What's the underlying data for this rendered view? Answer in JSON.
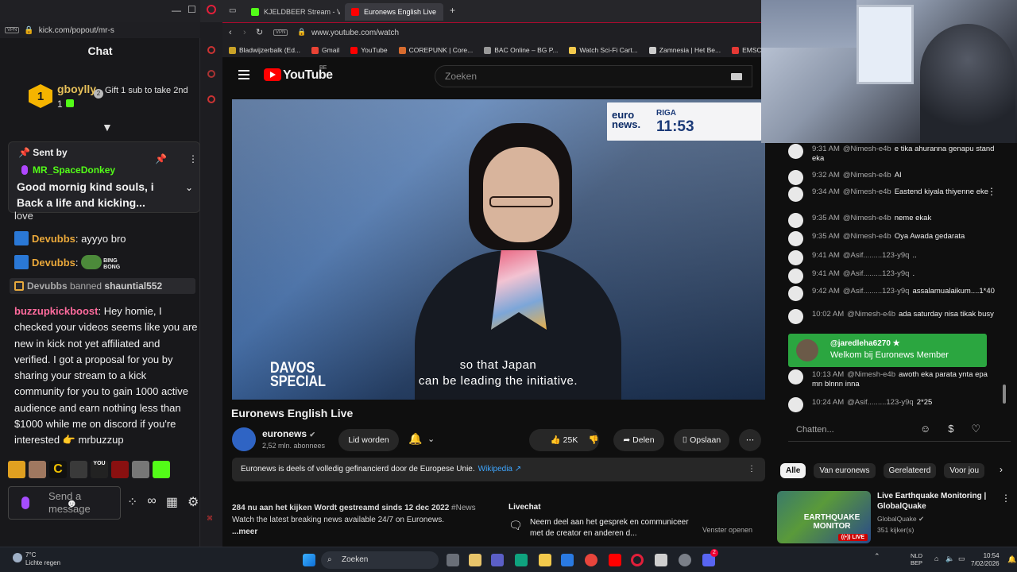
{
  "kick": {
    "url": "kick.com/popout/mr-s",
    "chat_title": "Chat",
    "gift": {
      "user": "gboylly",
      "rank": "1",
      "count": "1",
      "cta": "Gift 1 sub to take 2nd",
      "cta_num": "2"
    },
    "pinned": {
      "sent_by": "Sent by",
      "user": "MR_SpaceDonkey",
      "message": "Good mornig kind souls, i Back a life and kicking..."
    },
    "partial_line": "love",
    "messages": [
      {
        "user": "Devubbs",
        "text": "ayyyo bro"
      },
      {
        "user": "Devubbs",
        "text": ""
      }
    ],
    "ban": {
      "moderator": "Devubbs",
      "action": "banned",
      "target": "shauntial552"
    },
    "long_message": {
      "user": "buzzupkickboost",
      "text": "Hey homie, I checked your videos seems like you are new in kick not yet affiliated and verified. I got a proposal for you by sharing your stream to a kick community for you to gain 1000 active audience and earn nothing less than $1000 while me on discord if you're interested 👉 mrbuzzup"
    },
    "send_placeholder": "Send a message",
    "emote_text": {
      "bing": "BING BONG",
      "c": "C",
      "you": "YOU"
    }
  },
  "browser": {
    "tabs": [
      {
        "label": "KJELDBEER Stream - V",
        "icon_color": "#53fc18"
      },
      {
        "label": "Euronews English Live",
        "icon_color": "#ff0000"
      }
    ],
    "vpn": "VPN",
    "url": "www.youtube.com/watch",
    "bookmarks": [
      {
        "label": "Bladwijzerbalk (Ed...",
        "color": "#c9a227"
      },
      {
        "label": "Gmail",
        "color": "#ea4335"
      },
      {
        "label": "YouTube",
        "color": "#ff0000"
      },
      {
        "label": "COREPUNK | Core...",
        "color": "#d76b2e"
      },
      {
        "label": "BAC Online – BG P...",
        "color": "#999999"
      },
      {
        "label": "Watch Sci-Fi Cart...",
        "color": "#f2c94c"
      },
      {
        "label": "Zamnesia | Het Be...",
        "color": "#cccccc"
      },
      {
        "label": "EMSC - Eu",
        "color": "#e53935"
      }
    ]
  },
  "youtube": {
    "logo_text": "YouTube",
    "region": "BE",
    "search_placeholder": "Zoeken",
    "video": {
      "badge_logo": "euro news.",
      "badge_city": "RIGA",
      "badge_time": "11:53",
      "davos": "DAVOS SPECIAL",
      "subtitle_line1": "so that Japan",
      "subtitle_line2": "can be leading the initiative."
    },
    "title": "Euronews English Live",
    "channel": {
      "name": "euronews",
      "subs": "2,52 mln. abonnees"
    },
    "join_label": "Lid worden",
    "likes": "25K",
    "share_label": "Delen",
    "save_label": "Opslaan",
    "info_text": "Euronews is deels of volledig gefinancierd door de Europese Unie.",
    "info_link": "Wikipedia ↗",
    "desc_line1": "284 nu aan het kijken  Wordt gestreamd sinds 12 dec 2022",
    "desc_tag": "#News",
    "desc_line2": "Watch the latest breaking news available 24/7 on Euronews.",
    "desc_more": "...meer",
    "livechat_title": "Livechat",
    "livechat_text": "Neem deel aan het gesprek en communiceer met de creator en anderen d...",
    "livechat_open": "Venster openen"
  },
  "live_chat": {
    "messages": [
      {
        "time": "9:31 AM",
        "user": "@Nimesh-e4b",
        "text": "e tika ahuranna genapu stand eka"
      },
      {
        "time": "9:32 AM",
        "user": "@Nimesh-e4b",
        "text": "AI"
      },
      {
        "time": "9:34 AM",
        "user": "@Nimesh-e4b",
        "text": "Eastend kiyala thiyenne eke"
      },
      {
        "time": "9:35 AM",
        "user": "@Nimesh-e4b",
        "text": "neme ekak"
      },
      {
        "time": "9:35 AM",
        "user": "@Nimesh-e4b",
        "text": "Oya Awada gedarata"
      },
      {
        "time": "9:41 AM",
        "user": "@Asif.........123-y9q",
        "text": ".."
      },
      {
        "time": "9:41 AM",
        "user": "@Asif.........123-y9q",
        "text": "."
      },
      {
        "time": "9:42 AM",
        "user": "@Asif.........123-y9q",
        "text": "assalamualaikum....1*40"
      },
      {
        "time": "10:02 AM",
        "user": "@Nimesh-e4b",
        "text": "ada saturday nisa tikak busy"
      },
      {
        "time": "10:13 AM",
        "user": "@Nimesh-e4b",
        "text": "awoth eka parata ynta epa mn blnnn inna"
      },
      {
        "time": "10:24 AM",
        "user": "@Asif.........123-y9q",
        "text": "2*25"
      }
    ],
    "member": {
      "user": "@jaredleha6270 ★",
      "text": "Welkom bij Euronews Member"
    },
    "input_placeholder": "Chatten...",
    "chips": [
      "Alle",
      "Van euronews",
      "Gerelateerd",
      "Voor jou"
    ],
    "recommended": {
      "thumb_text": "EARTHQUAKE MONITOR",
      "live_badge": "((•)) LIVE",
      "title": "Live Earthquake Monitoring | GlobalQuake",
      "channel": "GlobalQuake",
      "views": "351 kijker(s)"
    }
  },
  "taskbar": {
    "weather_temp": "7°C",
    "weather_desc": "Lichte regen",
    "search": "Zoeken",
    "lang1": "NLD",
    "lang2": "BEP",
    "time": "10:54",
    "date": "7/02/2026",
    "badge": "2"
  }
}
